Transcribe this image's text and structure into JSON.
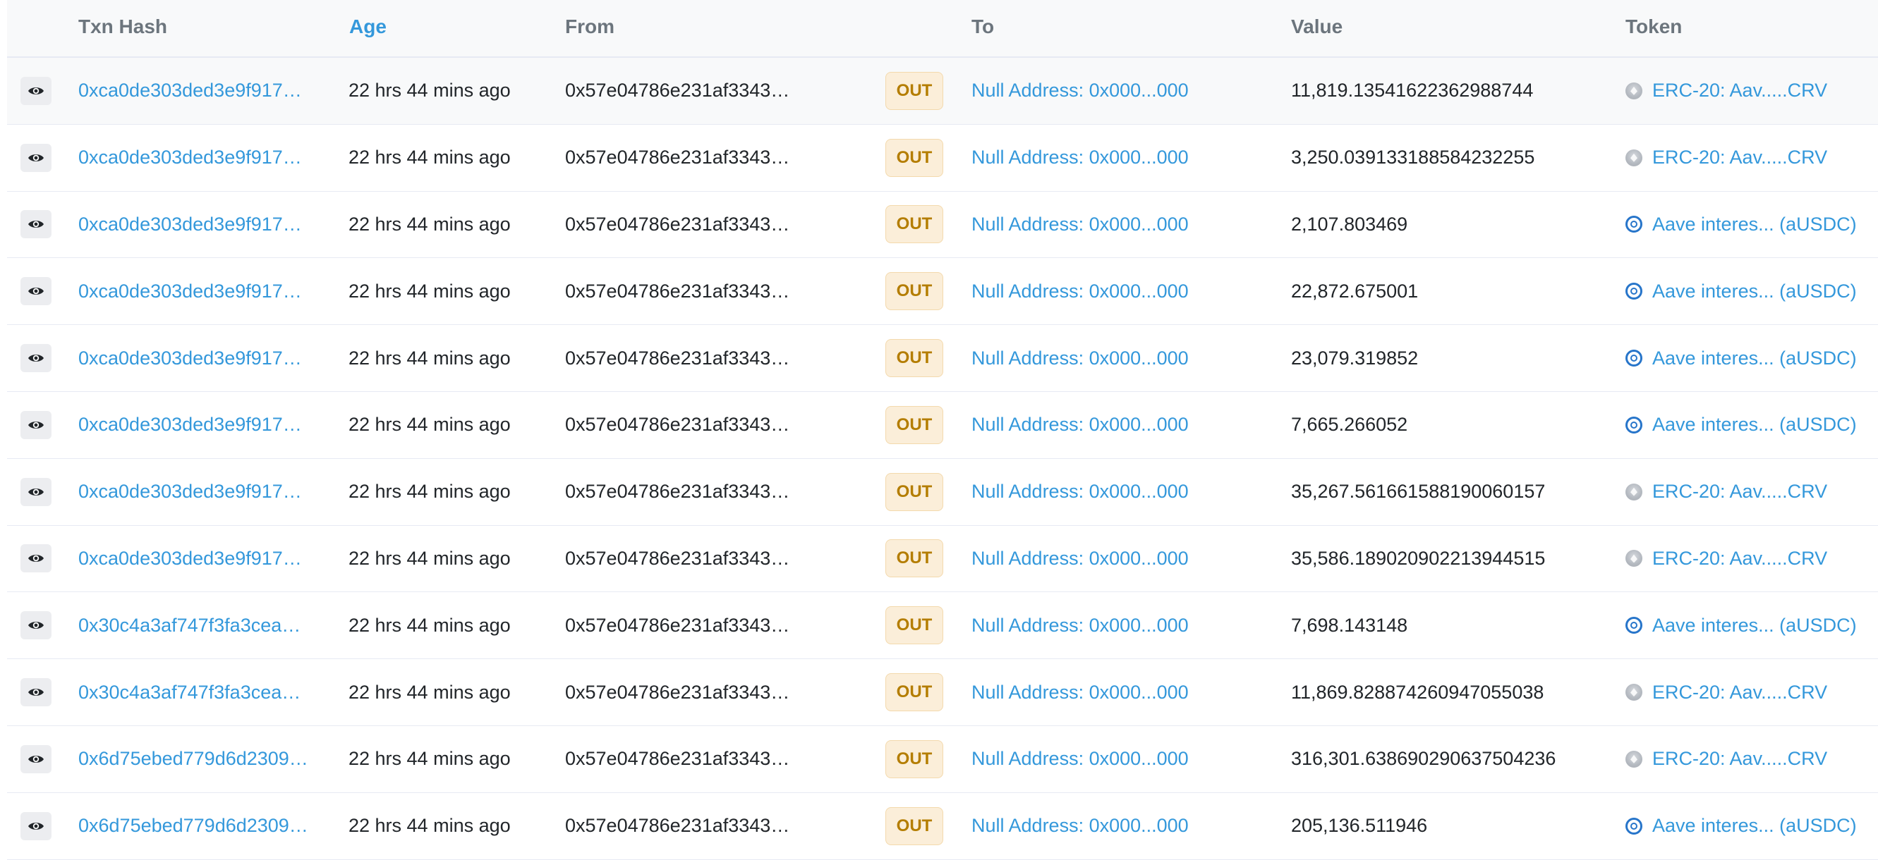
{
  "columns": {
    "txn_hash": "Txn Hash",
    "age": "Age",
    "from": "From",
    "to": "To",
    "value": "Value",
    "token": "Token"
  },
  "rows": [
    {
      "hash": "0xca0de303ded3e9f917…",
      "age": "22 hrs 44 mins ago",
      "from": "0x57e04786e231af3343…",
      "direction": "OUT",
      "to": "Null Address: 0x000...000",
      "value": "11,819.13541622362988744",
      "token": "ERC-20: Aav.....CRV",
      "token_icon": "crv-token-icon"
    },
    {
      "hash": "0xca0de303ded3e9f917…",
      "age": "22 hrs 44 mins ago",
      "from": "0x57e04786e231af3343…",
      "direction": "OUT",
      "to": "Null Address: 0x000...000",
      "value": "3,250.039133188584232255",
      "token": "ERC-20: Aav.....CRV",
      "token_icon": "crv-token-icon"
    },
    {
      "hash": "0xca0de303ded3e9f917…",
      "age": "22 hrs 44 mins ago",
      "from": "0x57e04786e231af3343…",
      "direction": "OUT",
      "to": "Null Address: 0x000...000",
      "value": "2,107.803469",
      "token": "Aave interes... (aUSDC)",
      "token_icon": "ausdc-token-icon"
    },
    {
      "hash": "0xca0de303ded3e9f917…",
      "age": "22 hrs 44 mins ago",
      "from": "0x57e04786e231af3343…",
      "direction": "OUT",
      "to": "Null Address: 0x000...000",
      "value": "22,872.675001",
      "token": "Aave interes... (aUSDC)",
      "token_icon": "ausdc-token-icon"
    },
    {
      "hash": "0xca0de303ded3e9f917…",
      "age": "22 hrs 44 mins ago",
      "from": "0x57e04786e231af3343…",
      "direction": "OUT",
      "to": "Null Address: 0x000...000",
      "value": "23,079.319852",
      "token": "Aave interes... (aUSDC)",
      "token_icon": "ausdc-token-icon"
    },
    {
      "hash": "0xca0de303ded3e9f917…",
      "age": "22 hrs 44 mins ago",
      "from": "0x57e04786e231af3343…",
      "direction": "OUT",
      "to": "Null Address: 0x000...000",
      "value": "7,665.266052",
      "token": "Aave interes... (aUSDC)",
      "token_icon": "ausdc-token-icon"
    },
    {
      "hash": "0xca0de303ded3e9f917…",
      "age": "22 hrs 44 mins ago",
      "from": "0x57e04786e231af3343…",
      "direction": "OUT",
      "to": "Null Address: 0x000...000",
      "value": "35,267.561661588190060157",
      "token": "ERC-20: Aav.....CRV",
      "token_icon": "crv-token-icon"
    },
    {
      "hash": "0xca0de303ded3e9f917…",
      "age": "22 hrs 44 mins ago",
      "from": "0x57e04786e231af3343…",
      "direction": "OUT",
      "to": "Null Address: 0x000...000",
      "value": "35,586.189020902213944515",
      "token": "ERC-20: Aav.....CRV",
      "token_icon": "crv-token-icon"
    },
    {
      "hash": "0x30c4a3af747f3fa3cea…",
      "age": "22 hrs 44 mins ago",
      "from": "0x57e04786e231af3343…",
      "direction": "OUT",
      "to": "Null Address: 0x000...000",
      "value": "7,698.143148",
      "token": "Aave interes... (aUSDC)",
      "token_icon": "ausdc-token-icon"
    },
    {
      "hash": "0x30c4a3af747f3fa3cea…",
      "age": "22 hrs 44 mins ago",
      "from": "0x57e04786e231af3343…",
      "direction": "OUT",
      "to": "Null Address: 0x000...000",
      "value": "11,869.828874260947055038",
      "token": "ERC-20: Aav.....CRV",
      "token_icon": "crv-token-icon"
    },
    {
      "hash": "0x6d75ebed779d6d2309…",
      "age": "22 hrs 44 mins ago",
      "from": "0x57e04786e231af3343…",
      "direction": "OUT",
      "to": "Null Address: 0x000...000",
      "value": "316,301.638690290637504236",
      "token": "ERC-20: Aav.....CRV",
      "token_icon": "crv-token-icon"
    },
    {
      "hash": "0x6d75ebed779d6d2309…",
      "age": "22 hrs 44 mins ago",
      "from": "0x57e04786e231af3343…",
      "direction": "OUT",
      "to": "Null Address: 0x000...000",
      "value": "205,136.511946",
      "token": "Aave interes... (aUSDC)",
      "token_icon": "ausdc-token-icon"
    }
  ],
  "colors": {
    "link": "#3498db",
    "out_badge_bg": "#fbeed9",
    "out_badge_text": "#b47d00",
    "header_bg": "#f8f9fa"
  }
}
